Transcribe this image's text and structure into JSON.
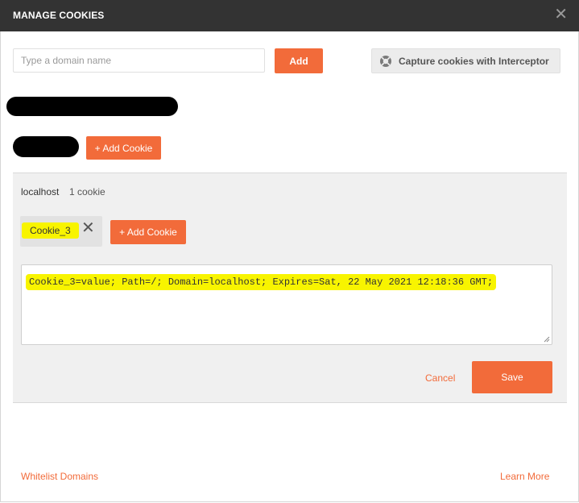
{
  "window": {
    "title": "MANAGE COOKIES",
    "close_icon": "close-icon"
  },
  "toolbar": {
    "domain_placeholder": "Type a domain name",
    "add_label": "Add",
    "interceptor_label": "Capture cookies with Interceptor",
    "interceptor_icon": "lifebuoy-icon"
  },
  "domain_group": {
    "add_cookie_label": "+ Add Cookie"
  },
  "panel": {
    "domain": "localhost",
    "count": "1 cookie",
    "cookie_chip": "Cookie_3",
    "add_cookie_label": "+ Add Cookie",
    "cookie_value": "Cookie_3=value; Path=/; Domain=localhost; Expires=Sat, 22 May 2021 12:18:36 GMT;",
    "cancel_label": "Cancel",
    "save_label": "Save"
  },
  "footer": {
    "whitelist_label": "Whitelist Domains",
    "learn_more_label": "Learn More"
  },
  "colors": {
    "accent": "#f26b3a",
    "highlight": "#f8f400",
    "titlebar": "#333333"
  }
}
